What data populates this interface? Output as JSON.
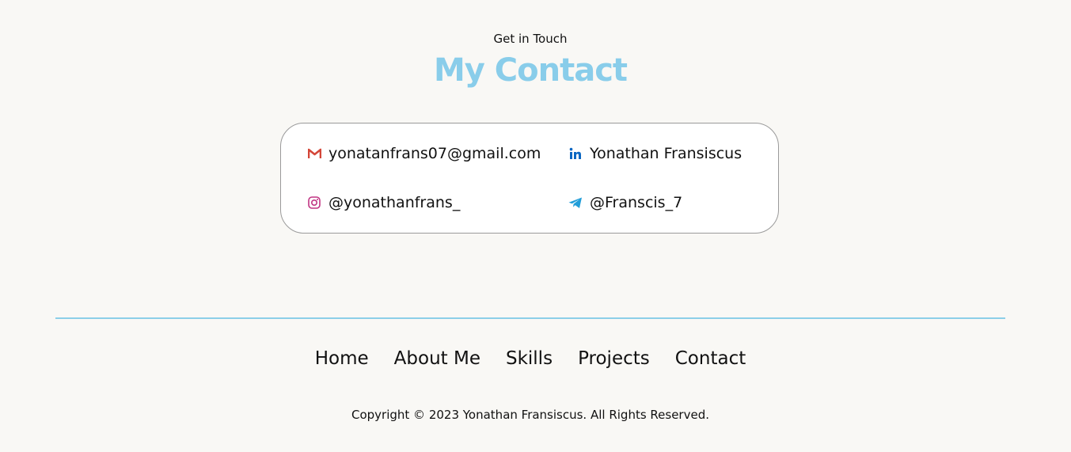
{
  "contact": {
    "eyebrow": "Get in Touch",
    "title": "My Contact",
    "items": [
      {
        "label": "yonatanfrans07@gmail.com",
        "icon": "gmail-icon"
      },
      {
        "label": "Yonathan Fransiscus",
        "icon": "linkedin-icon"
      },
      {
        "label": "@yonathanfrans_",
        "icon": "instagram-icon"
      },
      {
        "label": "@Franscis_7",
        "icon": "telegram-icon"
      }
    ]
  },
  "footer": {
    "nav": [
      "Home",
      "About Me",
      "Skills",
      "Projects",
      "Contact"
    ],
    "copyright": "Copyright © 2023 Yonathan Fransiscus. All Rights Reserved."
  },
  "colors": {
    "accent": "#89cdea",
    "background": "#f9f8f5",
    "card": "#ffffff",
    "divider": "#8ccfe8",
    "gmail": "#d44638",
    "linkedin": "#0a66c2",
    "instagram": "#c13584",
    "telegram": "#229ed9"
  }
}
